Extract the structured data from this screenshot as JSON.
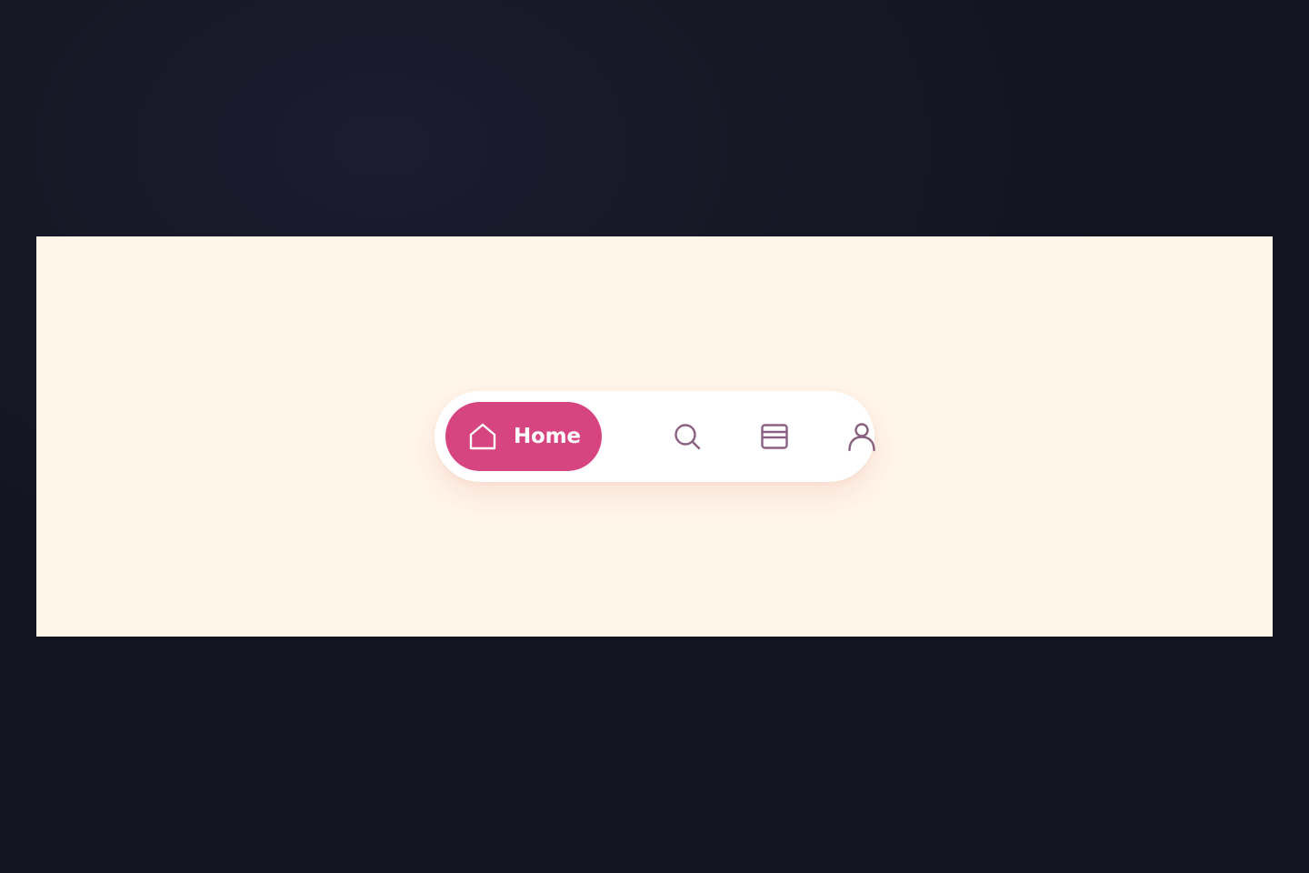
{
  "nav": {
    "active_item": {
      "label": "Home",
      "icon": "home-icon"
    },
    "items": [
      {
        "icon": "search-icon"
      },
      {
        "icon": "card-icon"
      },
      {
        "icon": "user-icon"
      }
    ]
  },
  "colors": {
    "page_background": "#151522",
    "stage_background": "#fff6ea",
    "navbar_background": "#ffffff",
    "accent": "#d6457f",
    "icon_inactive": "#8a6080",
    "active_text": "#ffffff"
  }
}
